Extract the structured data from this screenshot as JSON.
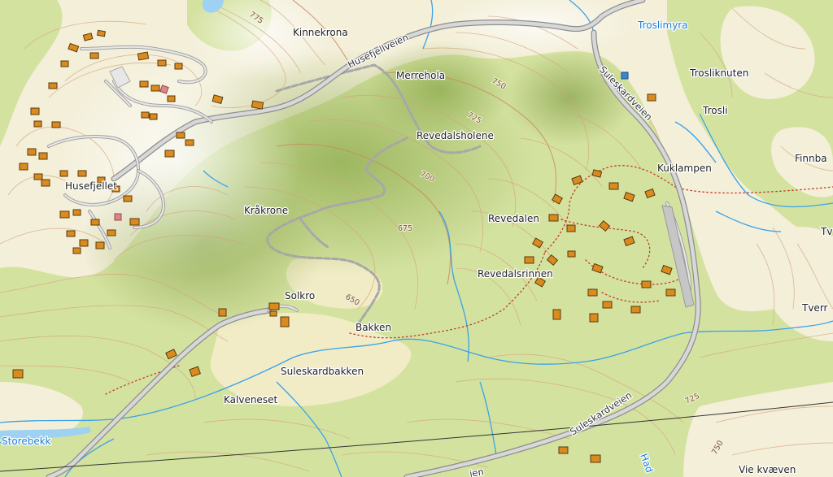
{
  "map": {
    "place_names": [
      {
        "id": "kinnekrona",
        "text": "Kinnekrona"
      },
      {
        "id": "merrehola",
        "text": "Merrehola"
      },
      {
        "id": "revedalsholene",
        "text": "Revedalsholene"
      },
      {
        "id": "krakrone",
        "text": "Kråkrone"
      },
      {
        "id": "husefjellet",
        "text": "Husefjellet"
      },
      {
        "id": "solkro",
        "text": "Solkro"
      },
      {
        "id": "bakken",
        "text": "Bakken"
      },
      {
        "id": "suleskardbakken",
        "text": "Suleskardbakken"
      },
      {
        "id": "kalveneset",
        "text": "Kalveneset"
      },
      {
        "id": "revedalen",
        "text": "Revedalen"
      },
      {
        "id": "revedalsrinnen",
        "text": "Revedalsrinnen"
      },
      {
        "id": "kuklampen",
        "text": "Kuklampen"
      },
      {
        "id": "troslikunten",
        "text": "Trosliknuten"
      },
      {
        "id": "trosli",
        "text": "Trosli"
      },
      {
        "id": "finnba",
        "text": "Finnba"
      },
      {
        "id": "tv",
        "text": "Tv"
      },
      {
        "id": "tverr",
        "text": "Tverr"
      },
      {
        "id": "vie-kvaeven",
        "text": "Vie kvæven"
      }
    ],
    "water_names": [
      {
        "id": "troslimyra",
        "text": "Troslimyra"
      },
      {
        "id": "storebekk",
        "text": "Storebekk"
      },
      {
        "id": "had",
        "text": "Had"
      }
    ],
    "road_names": [
      {
        "id": "husefjellveien",
        "text": "Husefjellveien"
      },
      {
        "id": "suleskardveien-north",
        "text": "Suleskardveien"
      },
      {
        "id": "suleskardveien-south",
        "text": "Suleskardveien"
      },
      {
        "id": "bottom-road",
        "text": "ien"
      }
    ],
    "contour_labels": [
      {
        "id": "c775-top",
        "text": "775"
      },
      {
        "id": "c750-mid",
        "text": "750"
      },
      {
        "id": "c725-mid",
        "text": "725"
      },
      {
        "id": "c700",
        "text": "700"
      },
      {
        "id": "c675",
        "text": "675"
      },
      {
        "id": "c650",
        "text": "650"
      },
      {
        "id": "c725-right",
        "text": "725"
      },
      {
        "id": "c750-bottom",
        "text": "750"
      }
    ],
    "colors": {
      "forest": "#d4e2a0",
      "forest_dark": "#a8c46a",
      "open_land": "#f3efd9",
      "water": "#3aa2ea",
      "building": "#d98b1f",
      "trail": "#c0392b",
      "contour": "#d7a07b"
    }
  }
}
